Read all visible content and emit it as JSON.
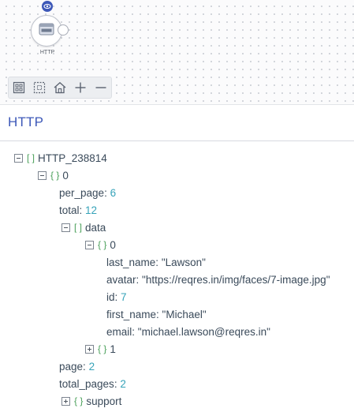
{
  "canvas": {
    "node_label": "HTTP",
    "node_icon": "http-icon",
    "badge_icon": "eye-icon",
    "toolbar_icons": [
      "fit-to-screen-icon",
      "select-area-icon",
      "home-icon",
      "zoom-in-icon",
      "zoom-out-icon"
    ]
  },
  "panel": {
    "title": "HTTP"
  },
  "tree": {
    "root": {
      "bracket": "[ ]",
      "key": "HTTP_238814"
    },
    "item0": {
      "bracket": "{ }",
      "key": "0"
    },
    "per_page": {
      "key": "per_page",
      "sep": ": ",
      "value": "6"
    },
    "total": {
      "key": "total",
      "sep": ": ",
      "value": "12"
    },
    "data": {
      "bracket": "[ ]",
      "key": "data"
    },
    "data0": {
      "bracket": "{ }",
      "key": "0"
    },
    "last_name": {
      "key": "last_name",
      "sep": ": ",
      "value": "\"Lawson\""
    },
    "avatar": {
      "key": "avatar",
      "sep": ": ",
      "value": "\"https://reqres.in/img/faces/7-image.jpg\""
    },
    "id": {
      "key": "id",
      "sep": ": ",
      "value": "7"
    },
    "first_name": {
      "key": "first_name",
      "sep": ": ",
      "value": "\"Michael\""
    },
    "email": {
      "key": "email",
      "sep": ": ",
      "value": "\"michael.lawson@reqres.in\""
    },
    "data1": {
      "bracket": "{ }",
      "key": "1"
    },
    "page": {
      "key": "page",
      "sep": ": ",
      "value": "2"
    },
    "total_pages": {
      "key": "total_pages",
      "sep": ": ",
      "value": "2"
    },
    "support": {
      "bracket": "{ }",
      "key": "support"
    }
  },
  "colors": {
    "accent": "#3d58b8",
    "bracket": "#4aa05a",
    "number": "#37a3b9",
    "text": "#3a4a5a"
  }
}
